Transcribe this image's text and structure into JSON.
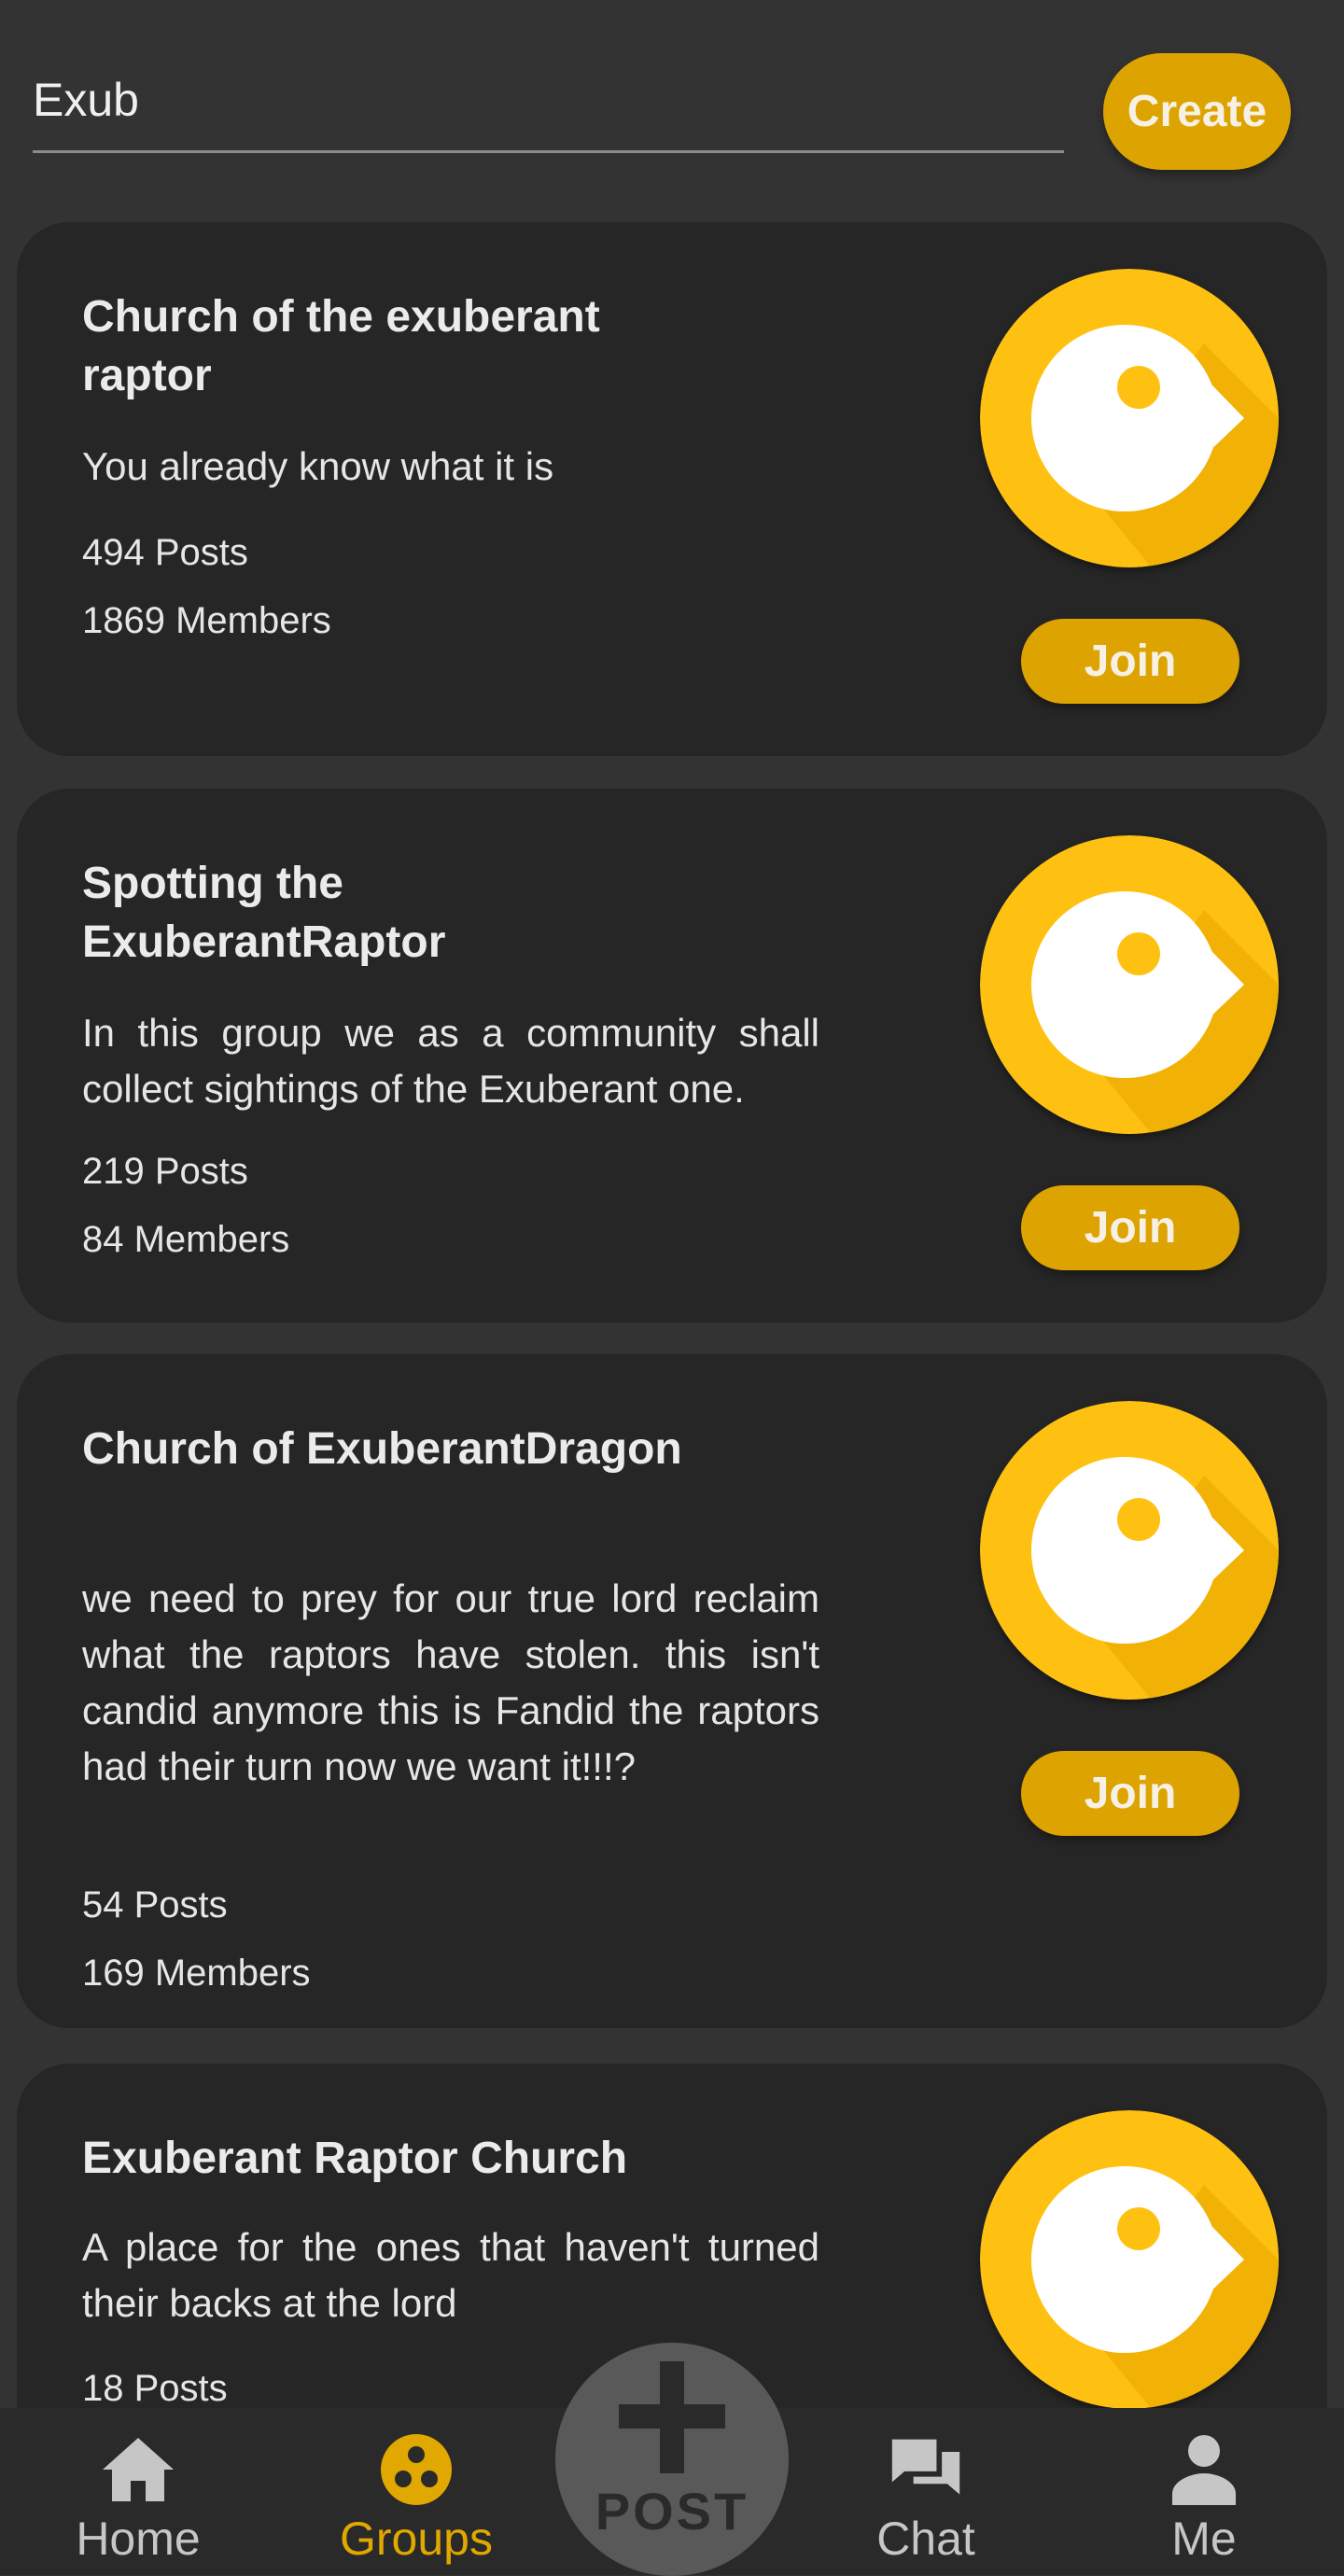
{
  "search": {
    "value": "Exub"
  },
  "create_label": "Create",
  "join_label": "Join",
  "groups": [
    {
      "title": "Church of the exuberant raptor",
      "description": "You already know what it is",
      "posts": "494 Posts",
      "members": "1869 Members"
    },
    {
      "title": "Spotting the ExuberantRaptor",
      "description": "In this group we as a community shall collect sightings of the Exuberant one.",
      "posts": "219 Posts",
      "members": "84 Members"
    },
    {
      "title": "Church of ExuberantDragon",
      "description": "we need to prey for our true lord reclaim what the raptors have stolen. this isn't candid anymore this is Fandid the raptors had their turn now we want it!!!?",
      "posts": "54 Posts",
      "members": "169 Members"
    },
    {
      "title": "Exuberant Raptor Church",
      "description": "A place for the ones that haven't turned their backs at the lord",
      "posts": "18 Posts",
      "members": ""
    }
  ],
  "nav": {
    "home": "Home",
    "groups": "Groups",
    "post": "POST",
    "chat": "Chat",
    "me": "Me",
    "active": "groups"
  },
  "colors": {
    "accent": "#dda300",
    "avatar": "#ffc111",
    "background": "#333333",
    "card": "#262626"
  },
  "icons": {
    "home": "home-icon",
    "groups": "groups-icon",
    "post": "plus-icon",
    "chat": "chat-icon",
    "me": "person-icon",
    "avatar": "bird-logo-icon"
  }
}
